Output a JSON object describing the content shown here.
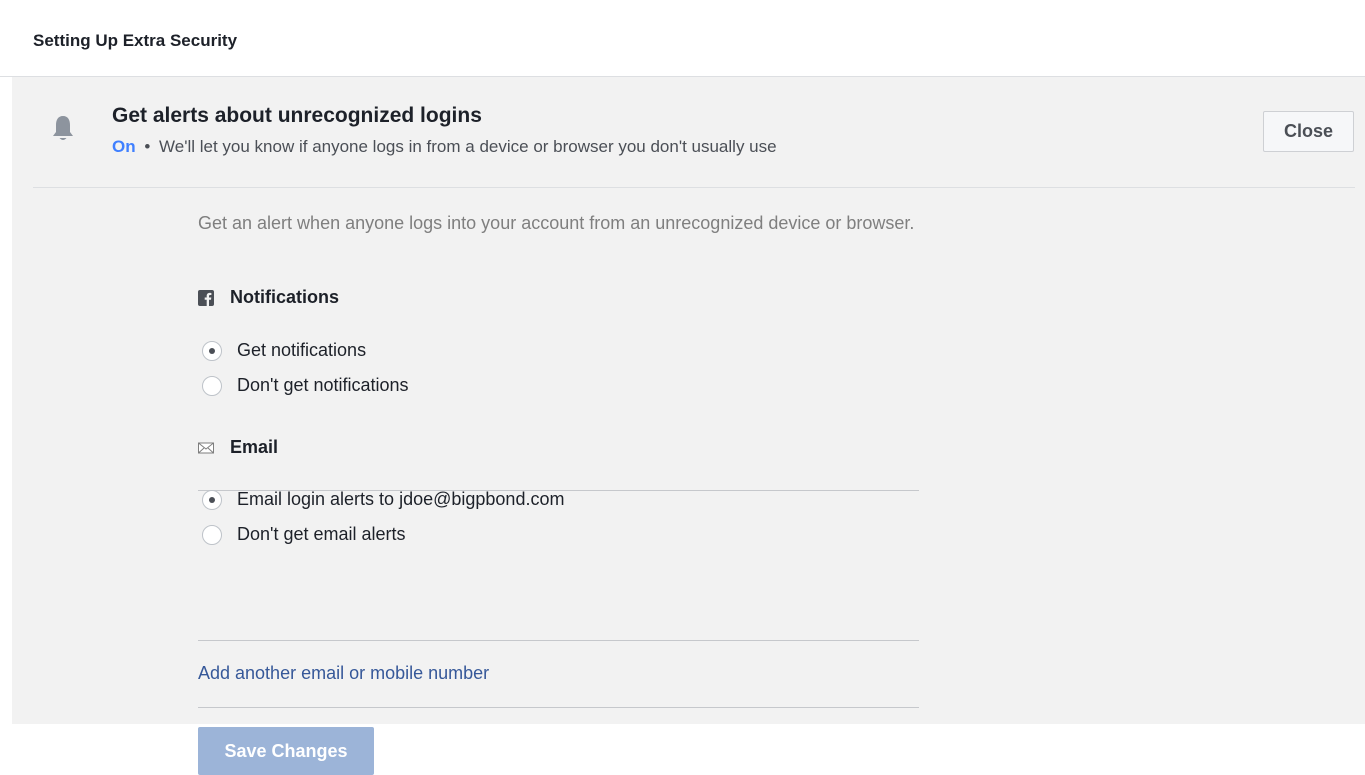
{
  "header": {
    "title": "Setting Up Extra Security"
  },
  "setting": {
    "icon": "bell-icon",
    "title": "Get alerts about unrecognized logins",
    "status": "On",
    "separator": "•",
    "description": "We'll let you know if anyone logs in from a device or browser you don't usually use",
    "close_label": "Close"
  },
  "content": {
    "intro": "Get an alert when anyone logs into your account from an unrecognized device or browser.",
    "notifications": {
      "icon": "facebook-icon",
      "heading": "Notifications",
      "options": [
        {
          "label": "Get notifications",
          "selected": true
        },
        {
          "label": "Don't get notifications",
          "selected": false
        }
      ]
    },
    "email": {
      "icon": "envelope-icon",
      "heading": "Email",
      "options": [
        {
          "label": "Email login alerts to jdoe@bigpbond.com",
          "selected": true
        },
        {
          "label": "Don't get email alerts",
          "selected": false
        }
      ]
    },
    "add_link": "Add another email or mobile number",
    "save_label": "Save Changes"
  },
  "colors": {
    "status_on": "#4080ff",
    "link": "#365899",
    "save_button_disabled": "#9cb4d8",
    "panel_bg": "#f2f2f2"
  }
}
